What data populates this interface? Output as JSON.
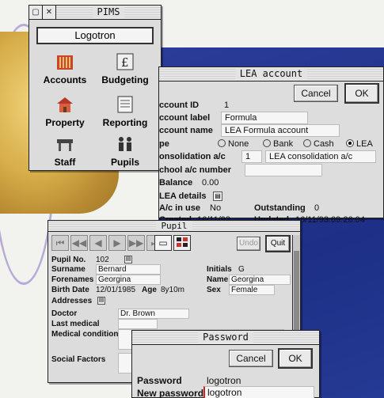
{
  "pims": {
    "title": "PIMS",
    "logo_text": "Logotron",
    "apps": [
      {
        "label": "Accounts",
        "icon": "accounts-icon",
        "glyph": "▥"
      },
      {
        "label": "Budgeting",
        "icon": "budgeting-icon",
        "glyph": "£"
      },
      {
        "label": "Property",
        "icon": "property-icon",
        "glyph": "⌂"
      },
      {
        "label": "Reporting",
        "icon": "reporting-icon",
        "glyph": "▤"
      },
      {
        "label": "Staff",
        "icon": "staff-icon",
        "glyph": "⊓"
      },
      {
        "label": "Pupils",
        "icon": "pupils-icon",
        "glyph": "👥"
      }
    ]
  },
  "lea": {
    "title": "LEA account",
    "cancel_label": "Cancel",
    "ok_label": "OK",
    "account_id_label": "ccount ID",
    "account_id": "1",
    "account_label_label": "ccount label",
    "account_label": "Formula",
    "account_name_label": "ccount name",
    "account_name": "LEA Formula account",
    "type_label": "pe",
    "type_options": [
      "None",
      "Bank",
      "Cash",
      "LEA"
    ],
    "type_selected": "LEA",
    "consolidation_label": "onsolidation a/c",
    "consolidation_id": "1",
    "consolidation_name": "LEA consolidation a/c",
    "school_ac_label": "chool a/c number",
    "balance_label": "Balance",
    "balance": "0.00",
    "lea_details_label": "LEA details",
    "ac_in_use_label": "A/c in use",
    "ac_in_use": "No",
    "outstanding_label": "Outstanding",
    "outstanding": "0",
    "created_label": "Created",
    "created": "16/11/93",
    "updated_label": "Updated",
    "updated": "16/11/93.09:26:04"
  },
  "pupil": {
    "title": "Pupil",
    "undo_label": "Undo",
    "quit_label": "Quit",
    "pupil_no_label": "Pupil No.",
    "pupil_no": "102",
    "surname_label": "Surname",
    "surname": "Bernard",
    "initials_label": "Initials",
    "initials": "G",
    "forenames_label": "Forenames",
    "forenames": "Georgina",
    "name_label": "Name",
    "name": "Georgina",
    "birth_date_label": "Birth Date",
    "birth_date": "12/01/1985",
    "age_label": "Age",
    "age": "8y10m",
    "sex_label": "Sex",
    "sex": "Female",
    "addresses_label": "Addresses",
    "doctor_label": "Doctor",
    "doctor": "Dr. Brown",
    "last_medical_label": "Last medical",
    "medical_condition_label": "Medical condition",
    "social_factors_label": "Social Factors"
  },
  "password": {
    "title": "Password",
    "cancel_label": "Cancel",
    "ok_label": "OK",
    "password_label": "Password",
    "password_value": "logotron",
    "new_password_label": "New password",
    "new_password_value": "logotron"
  }
}
